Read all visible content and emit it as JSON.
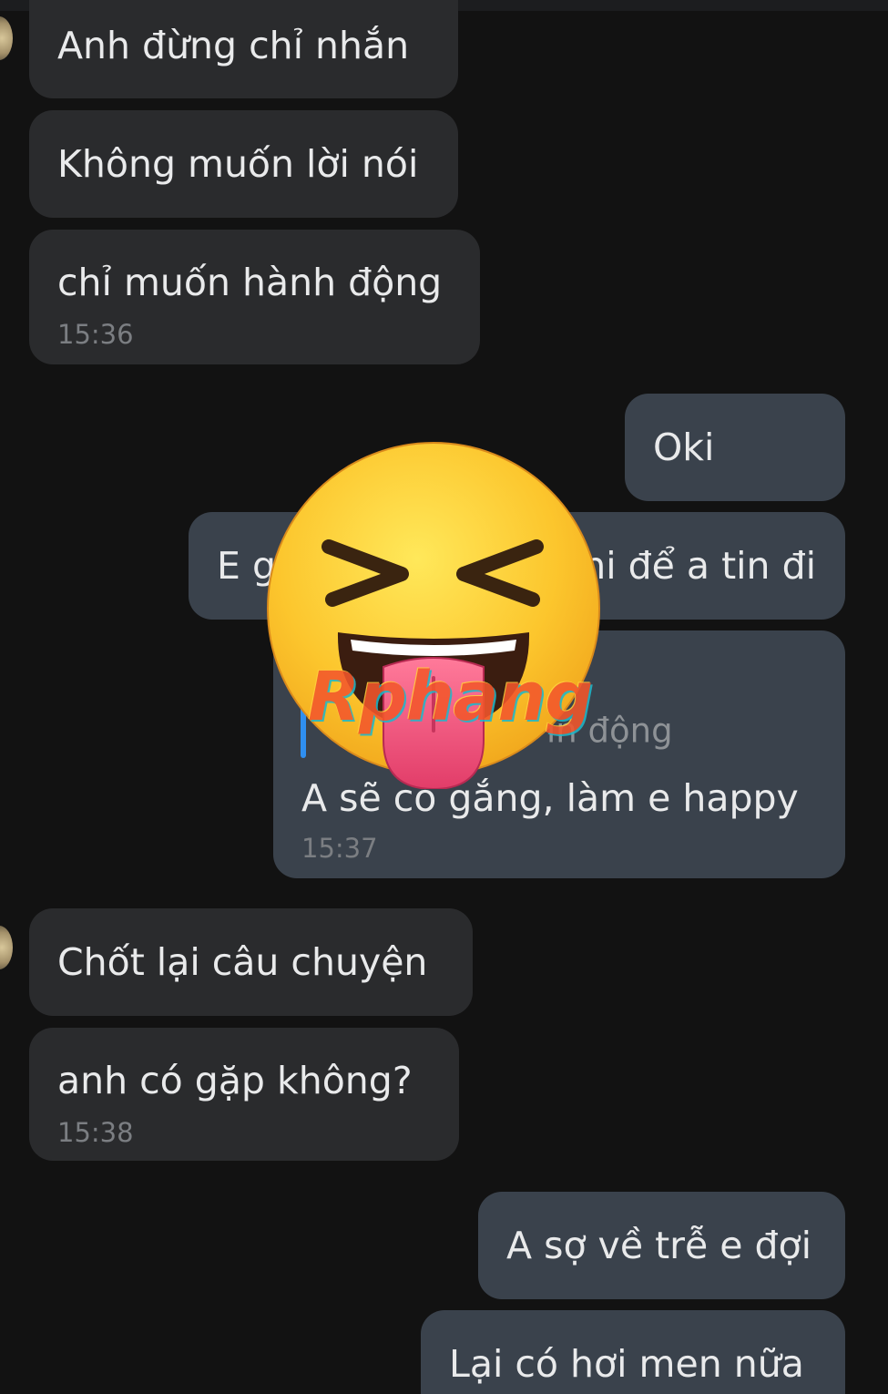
{
  "messages": [
    {
      "text": "Anh đừng chỉ nhắn"
    },
    {
      "text": "Không muốn lời nói"
    },
    {
      "text": "chỉ muốn hành động",
      "time": "15:36"
    },
    {
      "text": "Oki"
    },
    {
      "text": "E g",
      "text_right": "ni để a tin đi"
    },
    {
      "reply_snippet": "in động",
      "text": "A sẽ cố gắng, làm e happy",
      "time": "15:37"
    },
    {
      "text": "Chốt lại câu chuyện"
    },
    {
      "text": "anh có gặp không?",
      "time": "15:38"
    },
    {
      "text": "A sợ về trễ e đợi"
    },
    {
      "text": "Lại có hơi men nữa"
    }
  ],
  "overlay": {
    "sticker": "squinting-face-with-tongue-icon",
    "watermark": "Rphang"
  },
  "colors": {
    "background": "#121212",
    "incoming_bubble": "#2a2b2d",
    "outgoing_bubble": "#3a424c",
    "reply_bar": "#2f8ff0"
  }
}
